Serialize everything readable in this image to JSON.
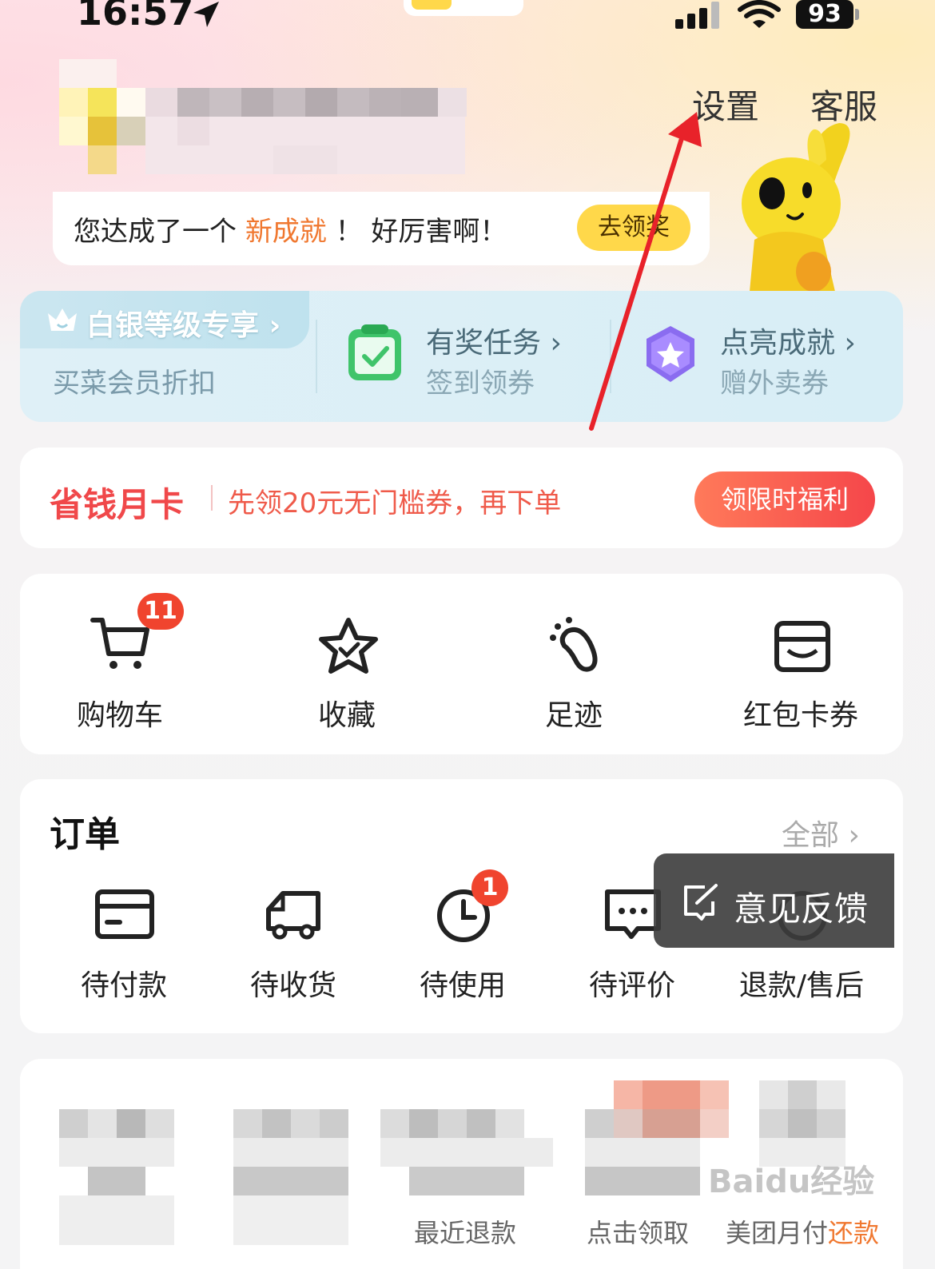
{
  "status_bar": {
    "time": "16:57",
    "battery": "93"
  },
  "header": {
    "settings_label": "设置",
    "service_label": "客服"
  },
  "achievement": {
    "text_before": "您达成了一个",
    "highlight": "新成就",
    "text_after": "！ 好厉害啊！",
    "button_label": "去领奖"
  },
  "member": {
    "level_title": "白银等级专享",
    "level_sub": "买菜会员折扣",
    "tasks": [
      {
        "title": "有奖任务",
        "sub": "签到领券",
        "icon": "calendar-check-icon"
      },
      {
        "title": "点亮成就",
        "sub": "赠外卖券",
        "icon": "star-badge-icon"
      }
    ]
  },
  "money_card": {
    "title": "省钱月卡",
    "desc": "先领20元无门槛券，再下单",
    "button_label": "领限时福利"
  },
  "quick_links": [
    {
      "label": "购物车",
      "icon": "cart-icon",
      "badge": "11"
    },
    {
      "label": "收藏",
      "icon": "star-icon"
    },
    {
      "label": "足迹",
      "icon": "footprint-icon"
    },
    {
      "label": "红包卡券",
      "icon": "wallet-icon"
    }
  ],
  "orders": {
    "title": "订单",
    "all_label": "全部",
    "items": [
      {
        "label": "待付款",
        "icon": "card-icon"
      },
      {
        "label": "待收货",
        "icon": "truck-icon"
      },
      {
        "label": "待使用",
        "icon": "clock-icon",
        "badge": "1"
      },
      {
        "label": "待评价",
        "icon": "chat-icon"
      },
      {
        "label": "退款/售后",
        "icon": "refund-icon"
      }
    ]
  },
  "feedback": {
    "label": "意见反馈"
  },
  "bottom_row": {
    "labels": [
      "最近退款",
      "点击领取",
      "美团月付",
      "还款"
    ]
  },
  "watermark": "Baidu经验",
  "colors": {
    "accent_yellow": "#ffd84a",
    "accent_red": "#f0484a",
    "badge_red": "#f0442e",
    "annotation_red": "#e8222a"
  }
}
